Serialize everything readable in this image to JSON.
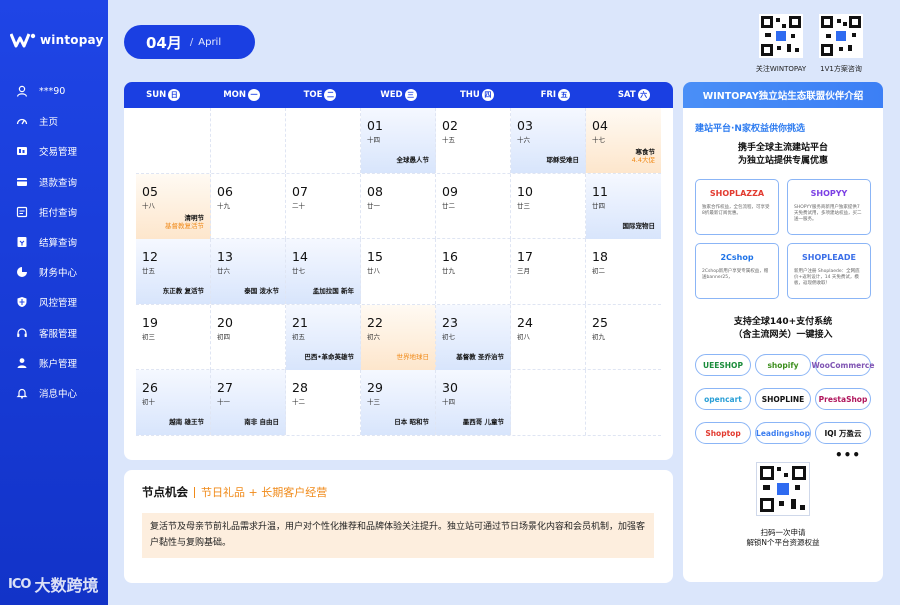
{
  "brand": {
    "name": "wintopay"
  },
  "sidebar": {
    "items": [
      {
        "label": "***90",
        "icon": "user-icon"
      },
      {
        "label": "主页",
        "icon": "dashboard-icon"
      },
      {
        "label": "交易管理",
        "icon": "transaction-icon"
      },
      {
        "label": "退款查询",
        "icon": "refund-icon"
      },
      {
        "label": "拒付查询",
        "icon": "chargeback-icon"
      },
      {
        "label": "结算查询",
        "icon": "settlement-icon"
      },
      {
        "label": "财务中心",
        "icon": "pie-chart-icon"
      },
      {
        "label": "风控管理",
        "icon": "shield-icon"
      },
      {
        "label": "客服管理",
        "icon": "headset-icon"
      },
      {
        "label": "账户管理",
        "icon": "account-icon"
      },
      {
        "label": "消息中心",
        "icon": "bell-icon"
      }
    ]
  },
  "watermark": {
    "mark": "ICO",
    "text": "大数跨境"
  },
  "month": {
    "num": "04月",
    "sep": "/",
    "en": "April"
  },
  "qr": [
    {
      "caption": "关注WINTOPAY"
    },
    {
      "caption": "1V1方案咨询"
    }
  ],
  "calendar": {
    "weekdays": [
      {
        "en": "SUN",
        "zh": "日"
      },
      {
        "en": "MON",
        "zh": "一"
      },
      {
        "en": "TOE",
        "zh": "二"
      },
      {
        "en": "WED",
        "zh": "三"
      },
      {
        "en": "THU",
        "zh": "四"
      },
      {
        "en": "FRI",
        "zh": "五"
      },
      {
        "en": "SAT",
        "zh": "六"
      }
    ],
    "weeks": [
      [
        {
          "d": "",
          "l": "",
          "ev": "",
          "ev2": "",
          "bg": ""
        },
        {
          "d": "",
          "l": "",
          "ev": "",
          "ev2": "",
          "bg": ""
        },
        {
          "d": "",
          "l": "",
          "ev": "",
          "ev2": "",
          "bg": ""
        },
        {
          "d": "01",
          "l": "十四",
          "ev": "全球愚人节",
          "ev2": "",
          "bg": "blue"
        },
        {
          "d": "02",
          "l": "十五",
          "ev": "",
          "ev2": "",
          "bg": ""
        },
        {
          "d": "03",
          "l": "十六",
          "ev": "耶稣受难日",
          "ev2": "",
          "bg": "blue"
        },
        {
          "d": "04",
          "l": "十七",
          "ev": "寒食节",
          "ev2": "4.4大促",
          "bg": "orange"
        }
      ],
      [
        {
          "d": "05",
          "l": "十八",
          "ev": "清明节",
          "ev2": "基督教复活节",
          "bg": "orange"
        },
        {
          "d": "06",
          "l": "十九",
          "ev": "",
          "ev2": "",
          "bg": ""
        },
        {
          "d": "07",
          "l": "二十",
          "ev": "",
          "ev2": "",
          "bg": ""
        },
        {
          "d": "08",
          "l": "廿一",
          "ev": "",
          "ev2": "",
          "bg": ""
        },
        {
          "d": "09",
          "l": "廿二",
          "ev": "",
          "ev2": "",
          "bg": ""
        },
        {
          "d": "10",
          "l": "廿三",
          "ev": "",
          "ev2": "",
          "bg": ""
        },
        {
          "d": "11",
          "l": "廿四",
          "ev": "国际宠物日",
          "ev2": "",
          "bg": "blue"
        }
      ],
      [
        {
          "d": "12",
          "l": "廿五",
          "ev": "东正教 复活节",
          "ev2": "",
          "bg": "blue"
        },
        {
          "d": "13",
          "l": "廿六",
          "ev": "泰国 泼水节",
          "ev2": "",
          "bg": "blue"
        },
        {
          "d": "14",
          "l": "廿七",
          "ev": "孟加拉国 新年",
          "ev2": "",
          "bg": "blue"
        },
        {
          "d": "15",
          "l": "廿八",
          "ev": "",
          "ev2": "",
          "bg": ""
        },
        {
          "d": "16",
          "l": "廿九",
          "ev": "",
          "ev2": "",
          "bg": ""
        },
        {
          "d": "17",
          "l": "三月",
          "ev": "",
          "ev2": "",
          "bg": ""
        },
        {
          "d": "18",
          "l": "初二",
          "ev": "",
          "ev2": "",
          "bg": ""
        }
      ],
      [
        {
          "d": "19",
          "l": "初三",
          "ev": "",
          "ev2": "",
          "bg": ""
        },
        {
          "d": "20",
          "l": "初四",
          "ev": "",
          "ev2": "",
          "bg": ""
        },
        {
          "d": "21",
          "l": "初五",
          "ev": "巴西•革命英雄节",
          "ev2": "",
          "bg": "blue"
        },
        {
          "d": "22",
          "l": "初六",
          "ev": "",
          "ev2": "世界地球日",
          "bg": "orange"
        },
        {
          "d": "23",
          "l": "初七",
          "ev": "基督教 圣乔治节",
          "ev2": "",
          "bg": "blue"
        },
        {
          "d": "24",
          "l": "初八",
          "ev": "",
          "ev2": "",
          "bg": ""
        },
        {
          "d": "25",
          "l": "初九",
          "ev": "",
          "ev2": "",
          "bg": ""
        }
      ],
      [
        {
          "d": "26",
          "l": "初十",
          "ev": "越南 雄王节",
          "ev2": "",
          "bg": "blue"
        },
        {
          "d": "27",
          "l": "十一",
          "ev": "南非 自由日",
          "ev2": "",
          "bg": "blue"
        },
        {
          "d": "28",
          "l": "十二",
          "ev": "",
          "ev2": "",
          "bg": ""
        },
        {
          "d": "29",
          "l": "十三",
          "ev": "日本 昭和节",
          "ev2": "",
          "bg": "blue"
        },
        {
          "d": "30",
          "l": "十四",
          "ev": "墨西哥 儿童节",
          "ev2": "",
          "bg": "blue"
        },
        {
          "d": "",
          "l": "",
          "ev": "",
          "ev2": "",
          "bg": ""
        },
        {
          "d": "",
          "l": "",
          "ev": "",
          "ev2": "",
          "bg": ""
        }
      ]
    ]
  },
  "nodes": {
    "title": "节点机会",
    "subtitle": "节日礼品 + 长期客户经营",
    "body": "复活节及母亲节前礼品需求升温，用户对个性化推荐和品牌体验关注提升。独立站可通过节日场景化内容和会员机制，加强客户黏性与复购基础。"
  },
  "partner": {
    "header": "WINTOPAY独立站生态联盟伙伴介绍",
    "tag": "建站平台·N家权益供你挑选",
    "t1_line1": "携手全球主流建站平台",
    "t1_line2": "为独立站提供专属优惠",
    "builders": [
      {
        "label": "SHOPLAZZA",
        "desc": "独家合作权益，全包流程，可享受8折最新订阅优惠。",
        "color": "#e23a2f"
      },
      {
        "label": "SHOPYY",
        "desc": "SHOPYY服务商新用户独家提供7天免费试用，多项建站权益，买二送一服务。",
        "color": "#7b3fe4"
      },
      {
        "label": "2Cshop",
        "desc": "2Cshop新用户享受专属权益，赠送banner25，",
        "color": "#1e73e8"
      },
      {
        "label": "SHOPLEADE",
        "desc": "新用户注册 Shoplaede：全网底价+返利设计，14 天免费试，模板，返现佣收取！",
        "color": "#3b6fe8"
      }
    ],
    "t2_line1": "支持全球140+支付系统",
    "t2_line2": "（含主流网关）一键接入",
    "payments": [
      {
        "label": "UEESHOP",
        "color": "#1a8c3a"
      },
      {
        "label": "shopify",
        "color": "#3d8f1e"
      },
      {
        "label": "WooCommerce",
        "color": "#7f54b3"
      },
      {
        "label": "opencart",
        "color": "#2a9fd6"
      },
      {
        "label": "SHOPLINE",
        "color": "#111111"
      },
      {
        "label": "PrestaShop",
        "color": "#b0155c"
      },
      {
        "label": "Shoptop",
        "color": "#e23a2f"
      },
      {
        "label": "Leadingshop",
        "color": "#3b7df0"
      },
      {
        "label": "IQI 万盈云",
        "color": "#111111"
      }
    ],
    "more": "•••",
    "qr_caption_1": "扫码一次申请",
    "qr_caption_2": "解锁N个平台资源权益"
  }
}
